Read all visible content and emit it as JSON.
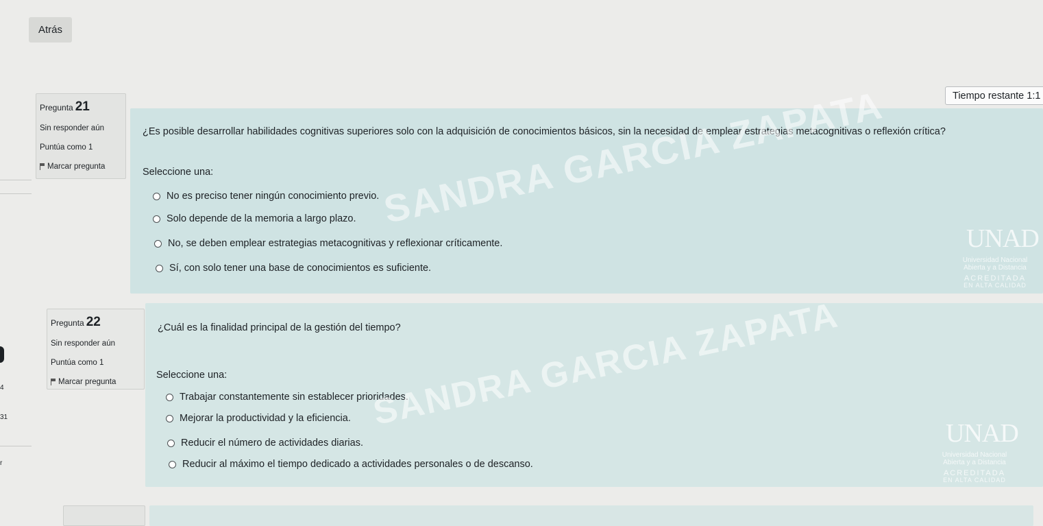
{
  "nav": {
    "back_label": "Atrás"
  },
  "timer": {
    "label": "Tiempo restante 1:1"
  },
  "watermark": {
    "name": "SANDRA GARCIA ZAPATA",
    "logo_brand": "UNAD",
    "logo_line1": "Universidad Nacional",
    "logo_line2": "Abierta y a Distancia",
    "logo_line3": "ACREDITADA",
    "logo_line4": "EN ALTA CALIDAD"
  },
  "questions": [
    {
      "number_prefix": "Pregunta",
      "number": "21",
      "status": "Sin responder aún",
      "score": "Puntúa como 1",
      "flag_label": "Marcar pregunta",
      "text": "¿Es posible desarrollar habilidades cognitivas superiores solo con la adquisición de conocimientos básicos, sin la necesidad de emplear estrategias metacognitivas o reflexión crítica?",
      "prompt": "Seleccione una:",
      "options": [
        "No es preciso tener ningún conocimiento previo.",
        "Solo depende de la memoria a largo plazo.",
        "No, se deben emplear estrategias metacognitivas y reflexionar críticamente.",
        "Sí, con solo tener una base de conocimientos es suficiente."
      ]
    },
    {
      "number_prefix": "Pregunta",
      "number": "22",
      "status": "Sin responder aún",
      "score": "Puntúa como 1",
      "flag_label": "Marcar pregunta",
      "text": "¿Cuál es la finalidad principal de la gestión del tiempo?",
      "prompt": "Seleccione una:",
      "options": [
        "Trabajar constantemente sin establecer prioridades.",
        "Mejorar la productividad y la eficiencia.",
        "Reducir el número de actividades diarias.",
        "Reducir al máximo el tiempo dedicado a actividades personales o de descanso."
      ]
    }
  ],
  "sidebar_fragments": [
    "4",
    "31",
    "r"
  ]
}
